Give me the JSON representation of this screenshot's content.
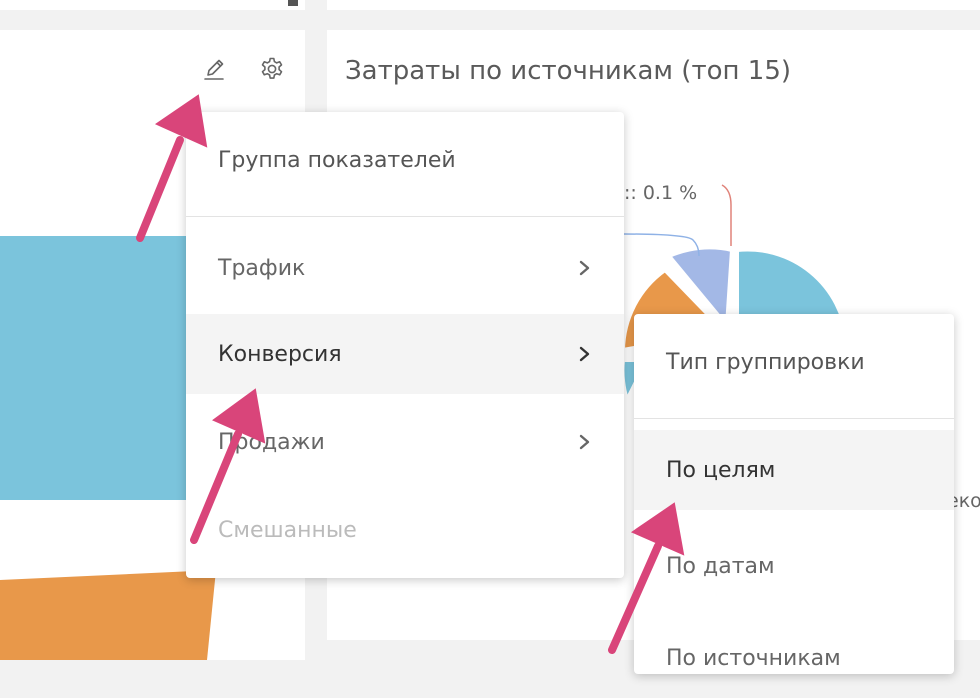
{
  "left_widget": {
    "edit_icon": "pencil-icon",
    "settings_icon": "gear-icon",
    "colors": {
      "blue_block": "#7bc4dc",
      "orange_block": "#e8984a"
    }
  },
  "right_widget": {
    "title": "Затраты по источникам (топ 15)",
    "pie_labels": [
      {
        "text": ":: 0.1 %"
      },
      {
        "text": "еко"
      }
    ],
    "pie_colors": [
      "#7bc4dc",
      "#e8984a",
      "#a3b8e6"
    ]
  },
  "metric_group_menu": {
    "header": "Группа показателей",
    "items": [
      {
        "label": "Трафик",
        "state": "normal",
        "has_submenu": true
      },
      {
        "label": "Конверсия",
        "state": "active",
        "has_submenu": true
      },
      {
        "label": "Продажи",
        "state": "normal",
        "has_submenu": true
      },
      {
        "label": "Смешанные",
        "state": "disabled",
        "has_submenu": false
      }
    ]
  },
  "grouping_submenu": {
    "header": "Тип группировки",
    "items": [
      {
        "label": "По целям",
        "state": "active"
      },
      {
        "label": "По датам",
        "state": "normal"
      },
      {
        "label": "По источникам",
        "state": "normal"
      }
    ]
  },
  "annotation_color": "#d9457a"
}
